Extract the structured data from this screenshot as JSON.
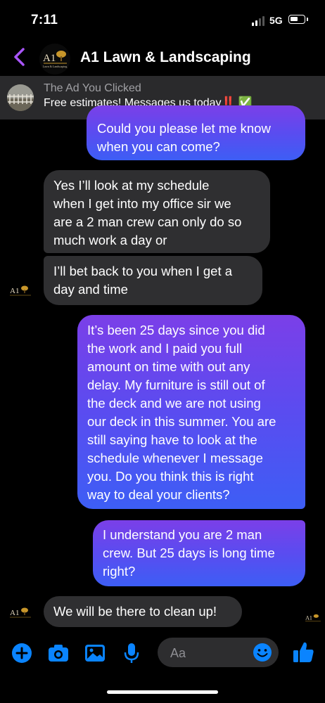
{
  "status_bar": {
    "time": "7:11",
    "network": "5G",
    "battery_icon": "battery-icon",
    "signal_icon": "signal-icon"
  },
  "header": {
    "title": "A1 Lawn & Landscaping",
    "back_icon": "chevron-left-icon",
    "avatar_text": "A1",
    "avatar_subtext": "Lawn & Landscaping"
  },
  "ad_banner": {
    "label": "The Ad You Clicked",
    "text": "Free estimates! Messages us today‼️ ✅"
  },
  "messages": [
    {
      "from": "me",
      "lines": [
        "Could you please let me know",
        "when you can come?"
      ]
    },
    {
      "from": "them",
      "lines": [
        "Yes I’ll look at my schedule",
        "when I get into my office sir we",
        "are a 2 man crew can only do so",
        "much work a day or"
      ]
    },
    {
      "from": "them",
      "lines": [
        "I’ll bet back to you when I get a",
        "day and time"
      ]
    },
    {
      "from": "me",
      "lines": [
        "It’s been 25 days since you did",
        "the work and I paid you full",
        "amount on time with out any",
        "delay. My furniture is still out of",
        "the deck and we are not using",
        "our deck in this summer. You are",
        "still saying have to look at the",
        "schedule whenever I message",
        "you. Do you think this is right",
        "way to deal your clients?"
      ]
    },
    {
      "from": "me",
      "lines": [
        "I understand you are 2 man",
        "crew. But 25 days is long time",
        "right?"
      ]
    },
    {
      "from": "them",
      "lines": [
        "We will be there to clean up!"
      ]
    }
  ],
  "composer": {
    "placeholder": "Aa",
    "icons": [
      "plus-circle-icon",
      "camera-icon",
      "photo-icon",
      "microphone-icon",
      "emoji-icon",
      "thumbs-up-icon"
    ]
  },
  "colors": {
    "accent": "#0a84ff",
    "outgoing_top": "#7b3fe8",
    "outgoing_bottom": "#3d5ef5",
    "incoming": "#2f2f31",
    "background": "#000000"
  }
}
